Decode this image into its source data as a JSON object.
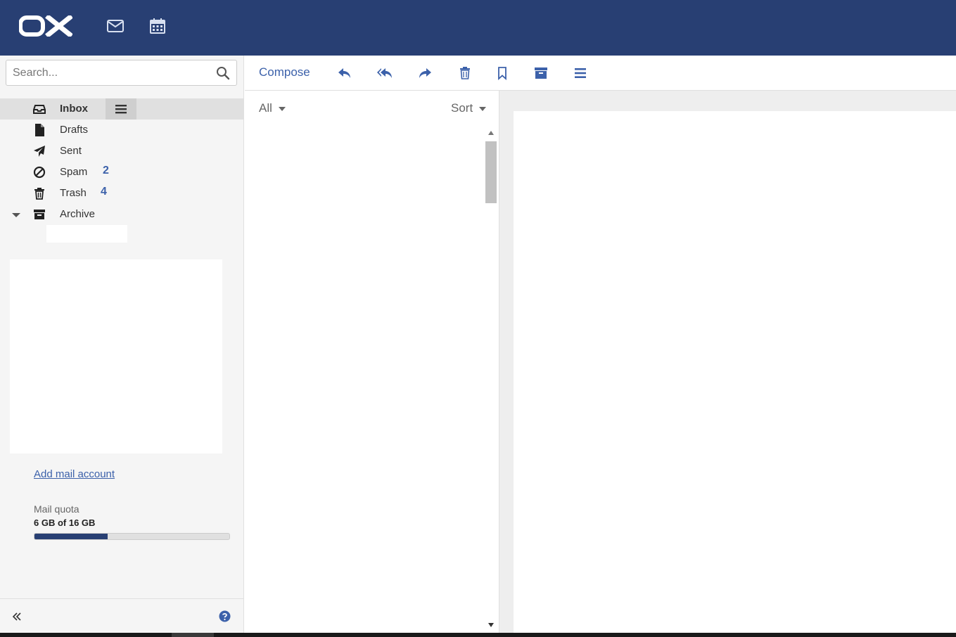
{
  "header": {
    "logo_text": "OX",
    "logo_color": "#ffffff",
    "background": "#283f73",
    "icons": [
      "mail-icon",
      "calendar-icon"
    ]
  },
  "search": {
    "placeholder": "Search..."
  },
  "folders": [
    {
      "label": "Inbox",
      "icon": "inbox-icon",
      "selected": true
    },
    {
      "label": "Drafts",
      "icon": "file-icon"
    },
    {
      "label": "Sent",
      "icon": "paper-plane-icon"
    },
    {
      "label": "Spam",
      "icon": "ban-icon",
      "count": "2"
    },
    {
      "label": "Trash",
      "icon": "trash-icon",
      "count": "4"
    },
    {
      "label": "Archive",
      "icon": "archive-icon",
      "expanded": true
    }
  ],
  "sidebar": {
    "add_account": "Add mail account",
    "quota_label": "Mail quota",
    "quota_value": "6 GB of 16 GB",
    "quota_fraction": 0.375
  },
  "toolbar": {
    "compose": "Compose",
    "icons": [
      "reply-icon",
      "reply-all-icon",
      "forward-icon",
      "delete-icon",
      "flag-icon",
      "archive-icon",
      "more-icon"
    ]
  },
  "list": {
    "filter_label": "All",
    "sort_label": "Sort"
  },
  "colors": {
    "accent": "#3c61aa",
    "header": "#283f73",
    "sidebar_bg": "#f5f5f5",
    "selected_bg": "#e0e0e0"
  }
}
